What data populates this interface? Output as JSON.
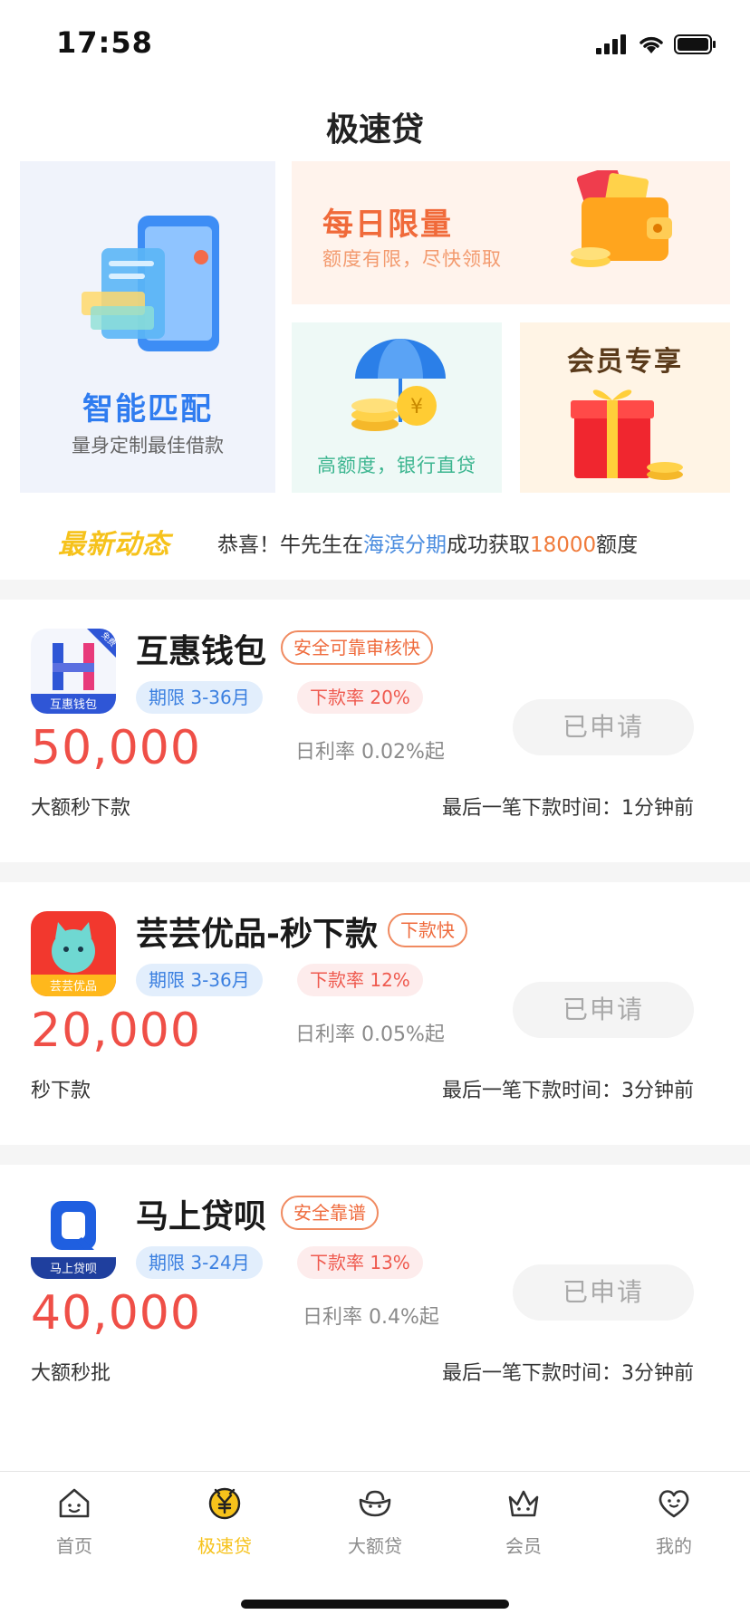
{
  "status_bar": {
    "time": "17:58"
  },
  "page_title": "极速贷",
  "banners": {
    "smart": {
      "title": "智能匹配",
      "subtitle": "量身定制最佳借款"
    },
    "daily": {
      "title": "每日限量",
      "subtitle": "额度有限，尽快领取"
    },
    "bank": {
      "subtitle": "高额度，银行直贷"
    },
    "vip": {
      "title": "会员专享"
    }
  },
  "news": {
    "tag": "最新动态",
    "prefix": "恭喜！牛先生在",
    "product": "海滨分期",
    "middle": "成功获取",
    "amount": "18000",
    "suffix": "额度"
  },
  "loans": [
    {
      "name": "互惠钱包",
      "badge": "安全可靠审核快",
      "logo_text": "互惠钱包",
      "logo_corner": "免费",
      "term": "期限 3-36月",
      "rate": "下款率 20%",
      "amount": "50,000",
      "daily_rate": "日利率 0.02%起",
      "button": "已申请",
      "desc": "大额秒下款",
      "last": "最后一笔下款时间：1分钟前"
    },
    {
      "name": "芸芸优品-秒下款",
      "badge": "下款快",
      "logo_text": "芸芸优品",
      "term": "期限 3-36月",
      "rate": "下款率 12%",
      "amount": "20,000",
      "daily_rate": "日利率 0.05%起",
      "button": "已申请",
      "desc": "秒下款",
      "last": "最后一笔下款时间：3分钟前"
    },
    {
      "name": "马上贷呗",
      "badge": "安全靠谱",
      "logo_text": "马上贷呗",
      "term": "期限 3-24月",
      "rate": "下款率 13%",
      "amount": "40,000",
      "daily_rate": "日利率 0.4%起",
      "button": "已申请",
      "desc": "大额秒批",
      "last": "最后一笔下款时间：3分钟前"
    }
  ],
  "tabs": [
    {
      "label": "首页",
      "icon": "home-icon"
    },
    {
      "label": "极速贷",
      "icon": "yen-coin-icon",
      "active": true
    },
    {
      "label": "大额贷",
      "icon": "ingot-icon"
    },
    {
      "label": "会员",
      "icon": "crown-icon"
    },
    {
      "label": "我的",
      "icon": "heart-face-icon"
    }
  ],
  "colors": {
    "accent": "#f6c21b",
    "amount": "#ef4f47",
    "badge": "#ef6b3d",
    "term": "#3a7fe0"
  }
}
